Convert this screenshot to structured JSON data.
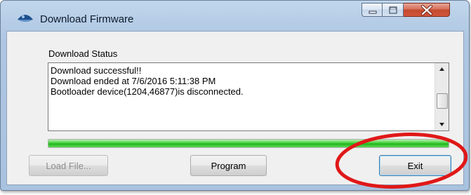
{
  "window": {
    "title": "Download Firmware",
    "controls": {
      "minimize_icon": "minimize-icon",
      "maximize_icon": "maximize-icon",
      "close_icon": "close-icon"
    }
  },
  "status": {
    "label": "Download Status",
    "lines": [
      "Download successful!!",
      "Download ended at 7/6/2016 5:11:38 PM",
      "Bootloader device(1204,46877)is disconnected."
    ]
  },
  "progress": {
    "fraction": 1.0,
    "color": "#1fb61a"
  },
  "buttons": {
    "load_file": "Load File...",
    "program": "Program",
    "exit": "Exit"
  },
  "annotation": {
    "color": "#e01818"
  }
}
